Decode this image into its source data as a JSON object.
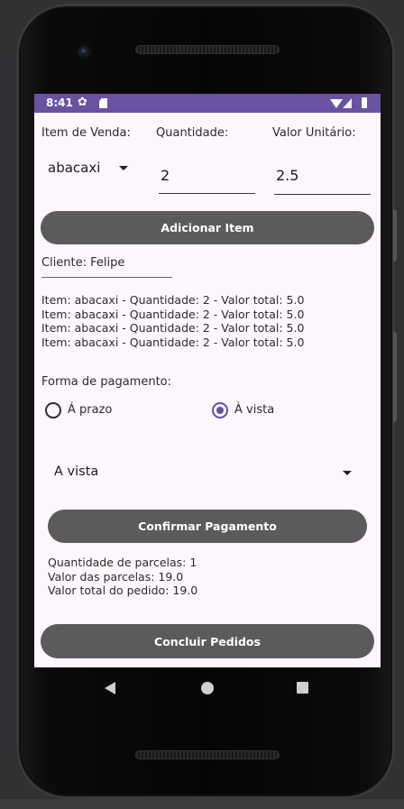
{
  "status_bar": {
    "time": "8:41",
    "settings_icon": "gear-icon",
    "sim_icon": "sd-card-icon",
    "wifi_icon": "wifi-icon",
    "signal_icon": "signal-icon",
    "battery_icon": "battery-icon"
  },
  "form": {
    "item_label": "Item de Venda:",
    "quantity_label": "Quantidade:",
    "unit_value_label": "Valor Unitário:",
    "item_selected": "abacaxi",
    "quantity_value": "2",
    "unit_value": "2.5",
    "add_button": "Adicionar Item"
  },
  "order": {
    "client": "Cliente: Felipe",
    "items": [
      "Item: abacaxi - Quantidade: 2 - Valor total: 5.0",
      "Item: abacaxi - Quantidade: 2 - Valor total: 5.0",
      "Item: abacaxi - Quantidade: 2 - Valor total: 5.0",
      "Item: abacaxi - Quantidade: 2 - Valor total: 5.0"
    ]
  },
  "payment": {
    "label": "Forma de pagamento:",
    "option_prazo": "Á prazo",
    "option_vista": "À vista",
    "selected": "À vista",
    "dropdown_value": "A vista",
    "confirm_button": "Confirmar Pagamento",
    "installments": "Quantidade de parcelas: 1",
    "installment_value": "Valor das parcelas: 19.0",
    "total": "Valor total do pedido: 19.0",
    "conclude_button": "Concluir Pedidos"
  },
  "colors": {
    "status_bar": "#6a51a1",
    "button": "#5b5b5b",
    "radio_accent": "#5f52a8",
    "screen_bg": "#fdf7fd"
  }
}
